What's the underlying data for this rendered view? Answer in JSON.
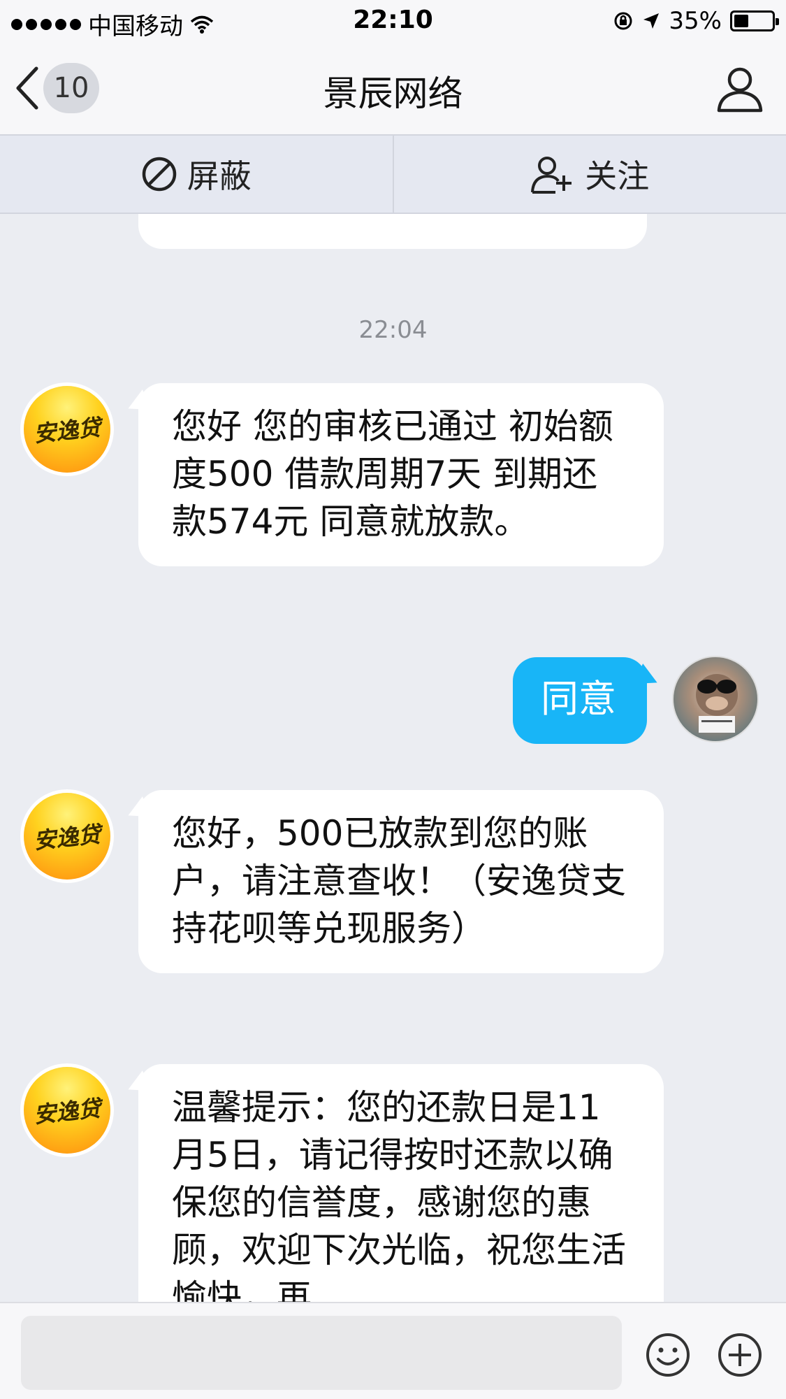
{
  "status_bar": {
    "carrier": "中国移动",
    "time": "22:10",
    "battery": "35%"
  },
  "nav": {
    "unread_count": "10",
    "title": "景辰网络"
  },
  "actions": {
    "block_label": "屏蔽",
    "follow_label": "关注"
  },
  "chat": {
    "timestamp": "22:04",
    "brand_avatar_text": "安逸贷",
    "messages": [
      {
        "direction": "in",
        "text": "您好 您的审核已通过 初始额度500 借款周期7天 到期还款574元 同意就放款。"
      },
      {
        "direction": "out",
        "text": "同意"
      },
      {
        "direction": "in",
        "text": "您好，500已放款到您的账户，请注意查收！（安逸贷支持花呗等兑现服务）"
      },
      {
        "direction": "in",
        "text": "温馨提示：您的还款日是11月5日，请记得按时还款以确保您的信誉度，感谢您的惠顾，欢迎下次光临，祝您生活愉快，再"
      }
    ]
  },
  "colors": {
    "outgoing_bubble": "#18b5f7",
    "incoming_bubble": "#ffffff",
    "background": "#ebedf2"
  },
  "icons": {
    "back": "chevron-left-icon",
    "profile": "person-icon",
    "block": "ban-icon",
    "follow": "add-person-icon",
    "emoji": "smiley-icon",
    "more": "plus-circle-icon"
  }
}
